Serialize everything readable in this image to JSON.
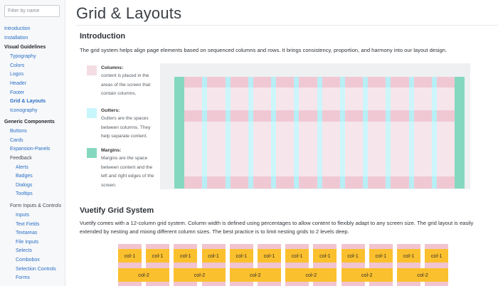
{
  "sidebar": {
    "filter_placeholder": "Filter by name",
    "items": [
      {
        "label": "Introduction",
        "kind": "link0"
      },
      {
        "label": "Installation",
        "kind": "link0"
      },
      {
        "label": "Visual Guidelines",
        "kind": "head"
      },
      {
        "label": "Typography",
        "kind": "link1"
      },
      {
        "label": "Colors",
        "kind": "link1"
      },
      {
        "label": "Logos",
        "kind": "link1"
      },
      {
        "label": "Header",
        "kind": "link1"
      },
      {
        "label": "Footer",
        "kind": "link1"
      },
      {
        "label": "Grid & Layouts",
        "kind": "active"
      },
      {
        "label": "Iconography",
        "kind": "link1"
      },
      {
        "label": "Generic Components",
        "kind": "head"
      },
      {
        "label": "Buttons",
        "kind": "link1"
      },
      {
        "label": "Cards",
        "kind": "link1"
      },
      {
        "label": "Expansion-Panels",
        "kind": "link1"
      },
      {
        "label": "Feedback",
        "kind": "plain"
      },
      {
        "label": "Alerts",
        "kind": "link2"
      },
      {
        "label": "Badges",
        "kind": "link2"
      },
      {
        "label": "Dialogs",
        "kind": "link2"
      },
      {
        "label": "Tooltips",
        "kind": "link2"
      },
      {
        "label": "Form Inputs & Controls",
        "kind": "plain"
      },
      {
        "label": "Inputs",
        "kind": "link2"
      },
      {
        "label": "Text Fields",
        "kind": "link2"
      },
      {
        "label": "Textareas",
        "kind": "link2"
      },
      {
        "label": "File Inputs",
        "kind": "link2"
      },
      {
        "label": "Selects",
        "kind": "link2"
      },
      {
        "label": "Combobox",
        "kind": "link2"
      },
      {
        "label": "Selection Controls",
        "kind": "link2"
      },
      {
        "label": "Forms",
        "kind": "link2"
      }
    ]
  },
  "main": {
    "page_title": "Grid & Layouts",
    "intro": {
      "heading": "Introduction",
      "text": "The grid system helps align page elements based on sequenced columns and rows. It brings consistency, proportion, and harmony into our layout design."
    },
    "legend": [
      {
        "title": "Columns:",
        "text": "content is placed in the areas of the screen that contain columns.",
        "color": "#f3dde3"
      },
      {
        "title": "Gutters:",
        "text": "Gutters are the spaces between columns. They help separate content.",
        "color": "#c7f6fb"
      },
      {
        "title": "Margins:",
        "text": "Margins are the space between content and the left and right edges of the screen.",
        "color": "#84d8bf"
      }
    ],
    "vuetify": {
      "heading": "Vuetify Grid System",
      "text": "Vuetify comes with a 12-column grid system. Column width is defined using percentages to allow content to flexibly adapt to any screen size. The grid layout is easily extended by nesting and mixing different column sizes. The best practice is to limit nesting grids to 2 levels deep.",
      "row1": [
        "col-1",
        "col-1",
        "col-1",
        "col-1",
        "col-1",
        "col-1",
        "col-1",
        "col-1",
        "col-1",
        "col-1",
        "col-1",
        "col-1"
      ],
      "row2": [
        "col-2",
        "col-2",
        "col-2",
        "col-2",
        "col-2",
        "col-2"
      ]
    }
  },
  "colors": {
    "column": "#f6e6eb",
    "column_band": "#f0c8d3",
    "gutter": "#cdf6fb",
    "gutter_band": "#b8eef5",
    "margin": "#84d8bf",
    "margin_light": "#dff2ec",
    "cell": "#fbc02d",
    "cell_bg": "#f1c4cf",
    "link": "#2a6fc4"
  }
}
